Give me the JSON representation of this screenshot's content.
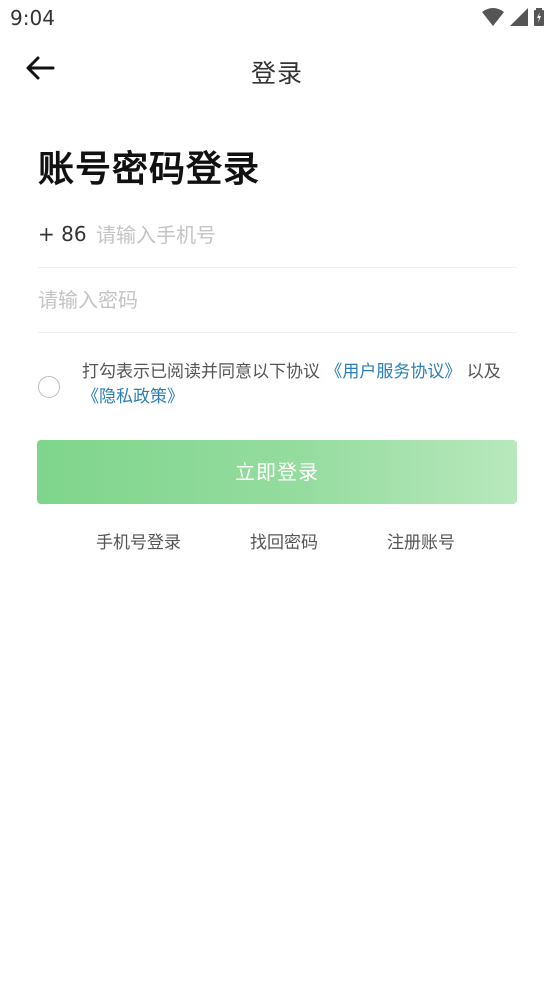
{
  "status_bar": {
    "time": "9:04",
    "icons": [
      "wifi-icon",
      "cell-signal-icon",
      "battery-icon"
    ]
  },
  "nav": {
    "back_icon": "arrow-left-icon",
    "title": "登录"
  },
  "page": {
    "title": "账号密码登录"
  },
  "form": {
    "country_code": "+ 86",
    "phone_placeholder": "请输入手机号",
    "phone_value": "",
    "password_placeholder": "请输入密码",
    "password_value": ""
  },
  "agreement": {
    "checked": false,
    "prefix": "打勾表示已阅读并同意以下协议",
    "user_agreement": "《用户服务协议》",
    "conjunction": " 以及",
    "privacy_policy": "《隐私政策》"
  },
  "login_button": {
    "label": "立即登录"
  },
  "links": {
    "phone_login": "手机号登录",
    "find_password": "找回密码",
    "register": "注册账号"
  },
  "colors": {
    "accent": "#7fd58c",
    "link": "#2a7fb8"
  }
}
